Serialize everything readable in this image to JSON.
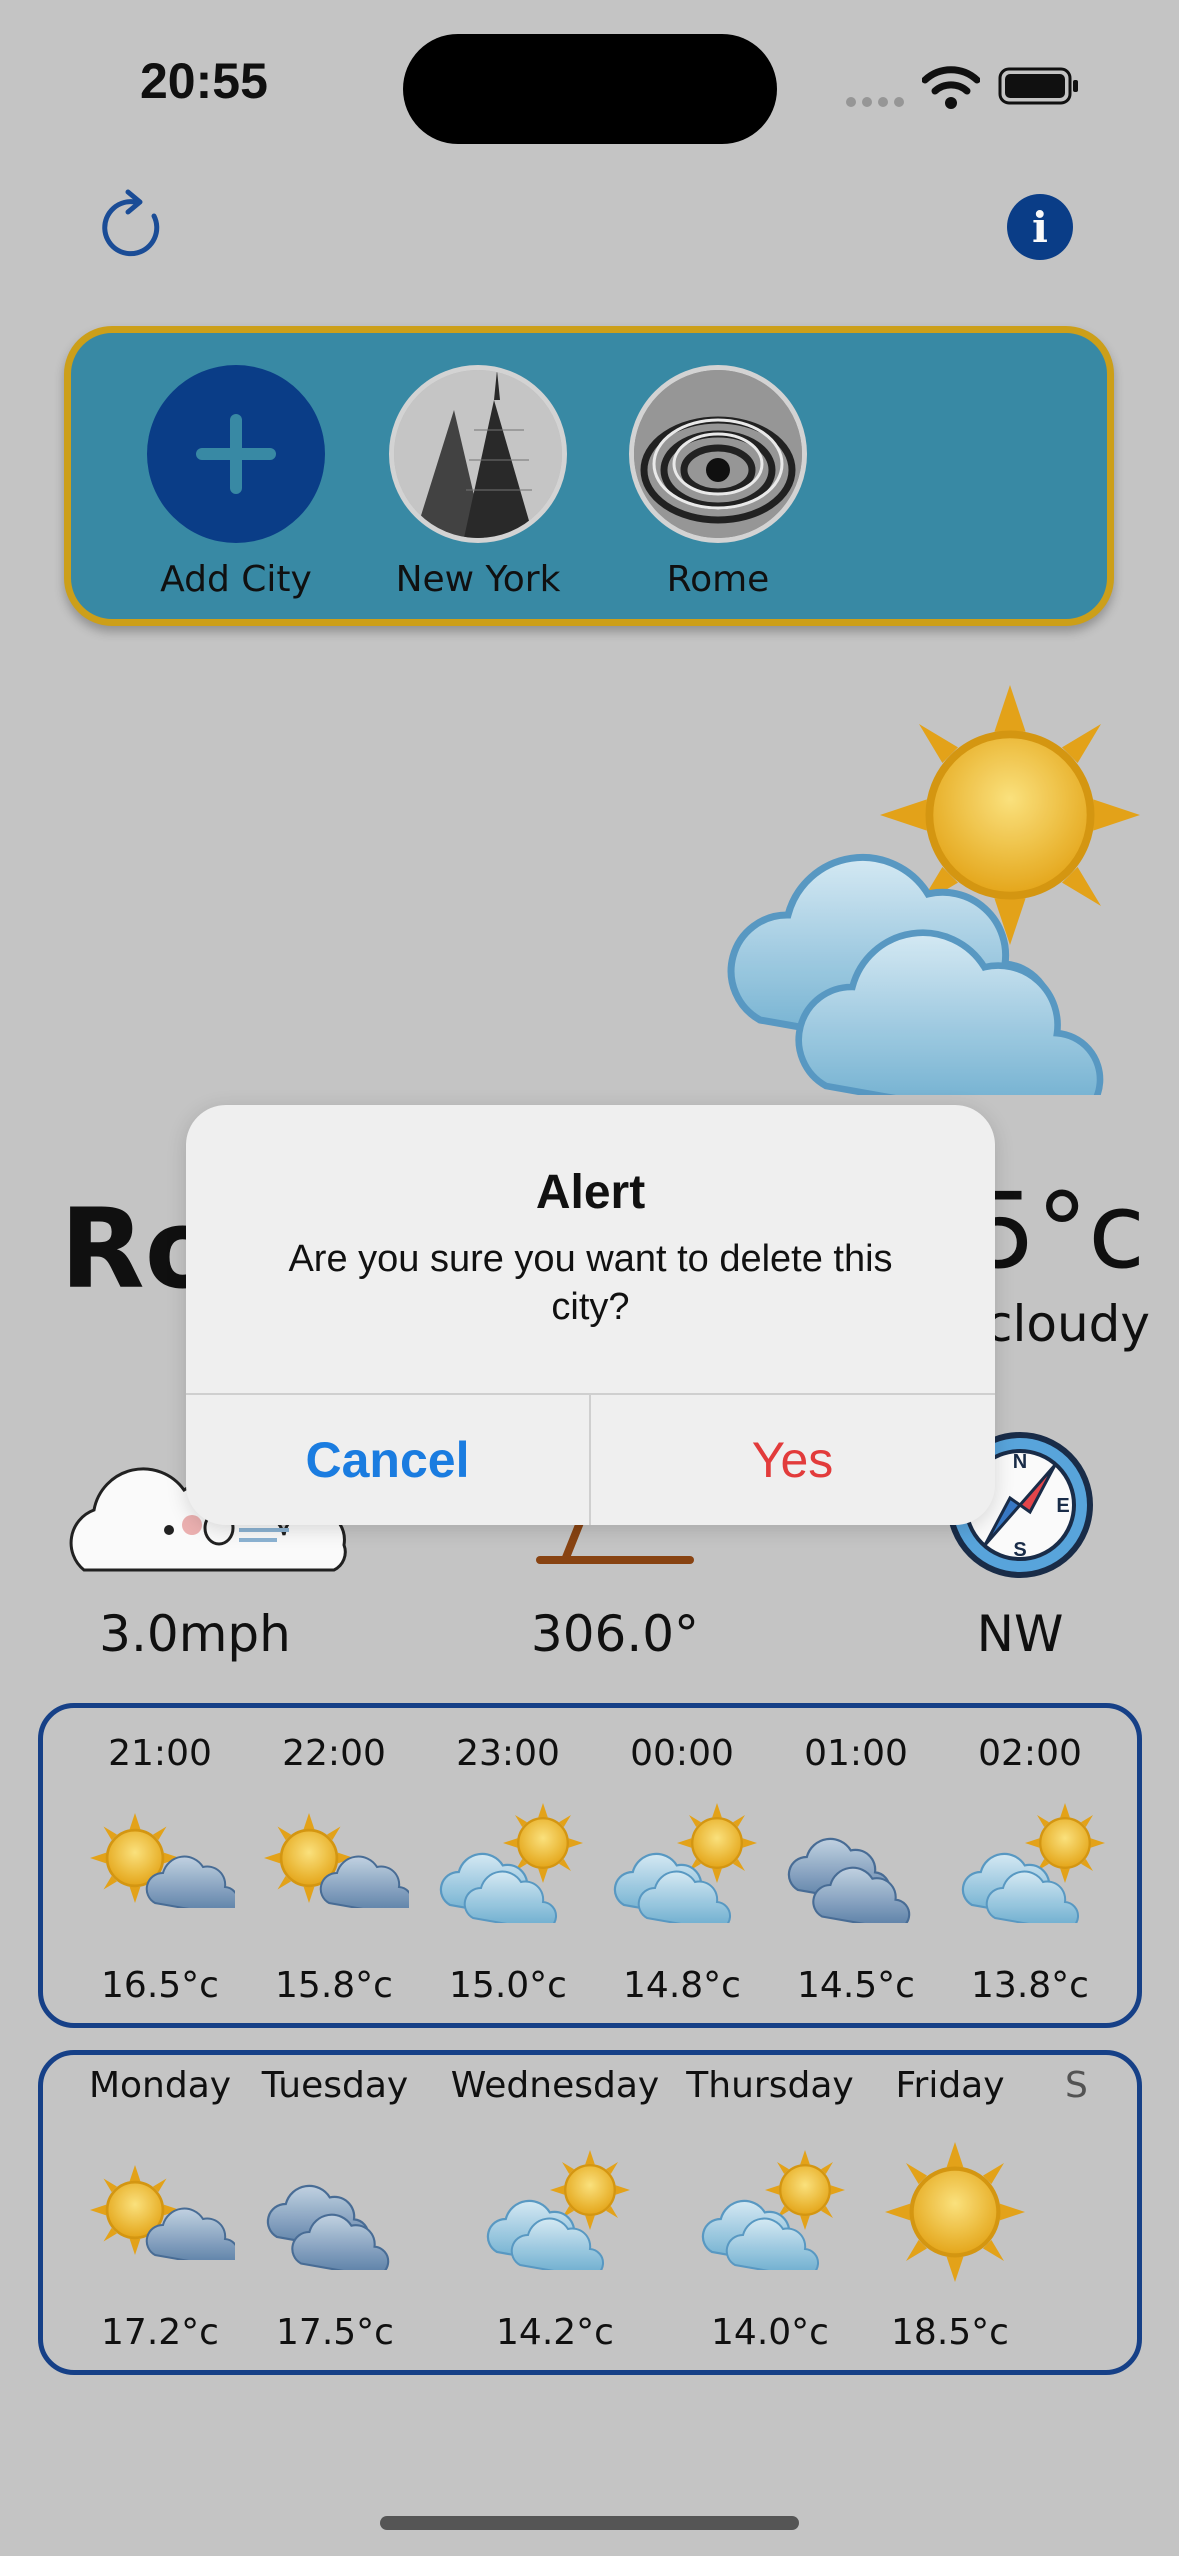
{
  "status_bar": {
    "time": "20:55"
  },
  "top_bar": {
    "refresh_icon": "refresh-icon",
    "info_icon": "info-icon"
  },
  "cities": [
    {
      "label": "Add City",
      "icon": "plus-icon"
    },
    {
      "label": "New York",
      "icon": "city-photo"
    },
    {
      "label": "Rome",
      "icon": "city-photo"
    }
  ],
  "current": {
    "city_partial": "Ro",
    "temp_partial": "5°c",
    "condition_partial": "cloudy",
    "wind_speed": "3.0mph",
    "wind_direction_degrees": "306.0°",
    "compass_direction": "NW",
    "compass_letters": {
      "n": "N",
      "s": "S",
      "e": "E"
    }
  },
  "hourly": [
    {
      "time": "21:00",
      "temp": "16.5°c",
      "icon": "sun-cloud-icon"
    },
    {
      "time": "22:00",
      "temp": "15.8°c",
      "icon": "sun-cloud-icon"
    },
    {
      "time": "23:00",
      "temp": "15.0°c",
      "icon": "cloud-sun-icon"
    },
    {
      "time": "00:00",
      "temp": "14.8°c",
      "icon": "cloud-sun-icon"
    },
    {
      "time": "01:00",
      "temp": "14.5°c",
      "icon": "clouds-icon"
    },
    {
      "time": "02:00",
      "temp": "13.8°c",
      "icon": "cloud-sun-icon"
    }
  ],
  "daily": [
    {
      "day": "Monday",
      "temp": "17.2°c",
      "icon": "sun-cloud-icon"
    },
    {
      "day": "Tuesday",
      "temp": "17.5°c",
      "icon": "clouds-icon"
    },
    {
      "day": "Wednesday",
      "temp": "14.2°c",
      "icon": "cloud-sun-icon"
    },
    {
      "day": "Thursday",
      "temp": "14.0°c",
      "icon": "cloud-sun-icon"
    },
    {
      "day": "Friday",
      "temp": "18.5°c",
      "icon": "sun-icon"
    },
    {
      "day": "S",
      "temp": "",
      "icon": ""
    }
  ],
  "alert": {
    "title": "Alert",
    "message": "Are you sure you want to delete this city?",
    "cancel_label": "Cancel",
    "yes_label": "Yes"
  },
  "colors": {
    "background": "#c8c8c8",
    "city_bar": "#3a8ca8",
    "city_bar_border": "#d1a31a",
    "panel_border": "#17428a",
    "cancel": "#1a7ce0",
    "yes": "#e23b3b",
    "add_city": "#0b3f8a"
  }
}
